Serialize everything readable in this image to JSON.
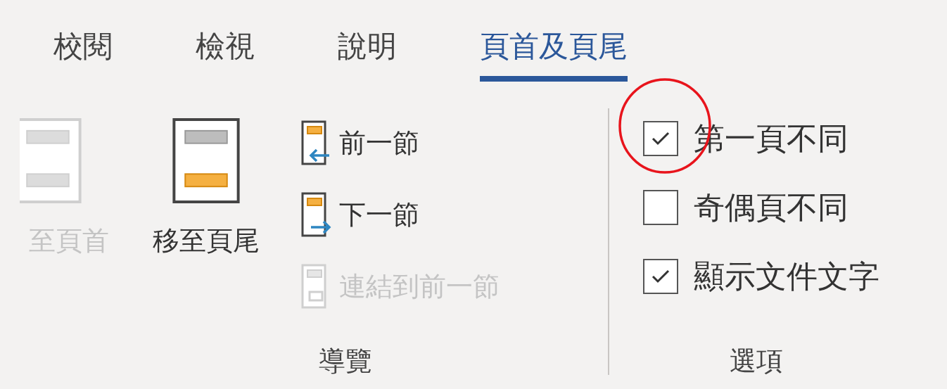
{
  "tabs": [
    {
      "label": "校閱",
      "selected": false
    },
    {
      "label": "檢視",
      "selected": false
    },
    {
      "label": "說明",
      "selected": false
    },
    {
      "label": "頁首及頁尾",
      "selected": true
    }
  ],
  "navigation": {
    "label": "導覽",
    "large_buttons": [
      {
        "kind": "header",
        "label": "至頁首",
        "disabled": true
      },
      {
        "kind": "footer",
        "label": "移至頁尾",
        "disabled": false
      }
    ],
    "small_buttons": [
      {
        "kind": "previous",
        "label": "前一節",
        "disabled": false
      },
      {
        "kind": "next",
        "label": "下一節",
        "disabled": false
      },
      {
        "kind": "link",
        "label": "連結到前一節",
        "disabled": true
      }
    ]
  },
  "options": {
    "label": "選項",
    "checkboxes": [
      {
        "label": "第一頁不同",
        "checked": true,
        "circled": true
      },
      {
        "label": "奇偶頁不同",
        "checked": false,
        "circled": false
      },
      {
        "label": "顯示文件文字",
        "checked": true,
        "circled": false
      }
    ]
  }
}
